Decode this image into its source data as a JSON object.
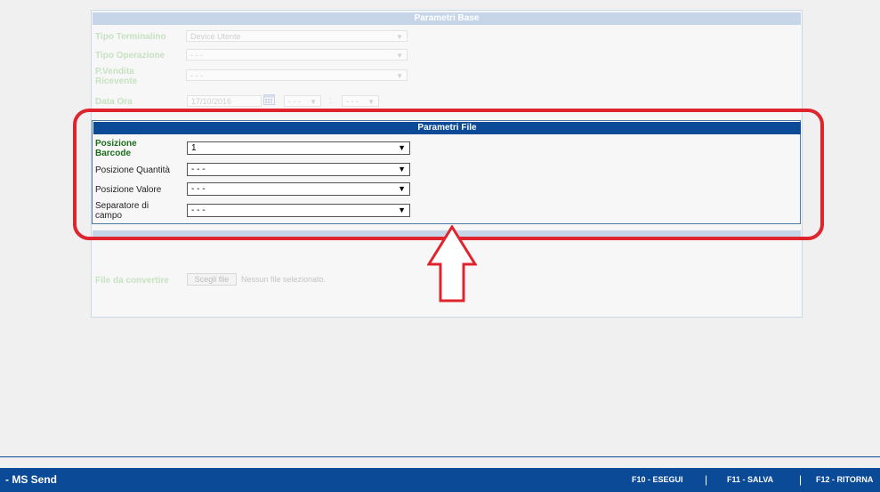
{
  "parametri_base": {
    "title": "Parametri Base",
    "tipo_terminalino_label": "Tipo Terminalino",
    "tipo_terminalino_value": "Device Utente",
    "tipo_operazione_label": "Tipo Operazione",
    "tipo_operazione_value": "- - -",
    "pvendita_label_1": "P.Vendita",
    "pvendita_label_2": "Ricevente",
    "pvendita_value": "- - -",
    "data_ora_label": "Data Ora",
    "data_value": "17/10/2016",
    "hour_value": "- - -",
    "time_separator": ":",
    "minute_value": "- - -"
  },
  "parametri_file": {
    "title": "Parametri File",
    "posizione_barcode_label_1": "Posizione",
    "posizione_barcode_label_2": "Barcode",
    "posizione_barcode_value": "1",
    "posizione_quantita_label": "Posizione Quantità",
    "posizione_quantita_value": "- - -",
    "posizione_valore_label": "Posizione Valore",
    "posizione_valore_value": "- - -",
    "separatore_label_1": "Separatore di",
    "separatore_label_2": "campo",
    "separatore_value": "- - -"
  },
  "file_input": {
    "label": "File da convertire",
    "button_label": "Scegli file",
    "status": "Nessun file selezionato."
  },
  "footer": {
    "app_name": "- MS Send",
    "f10": "F10 - ESEGUI",
    "f11": "F11 - SALVA",
    "f12": "F12 - RITORNA",
    "separator": "|"
  },
  "colors": {
    "brand_blue": "#0a4a96",
    "highlight_red": "#e0242e",
    "label_green": "#1d6d1d"
  },
  "icons": {
    "calendar": "calendar-icon",
    "dropdown": "chevron-down-icon",
    "annotation_arrow": "up-arrow-icon"
  }
}
